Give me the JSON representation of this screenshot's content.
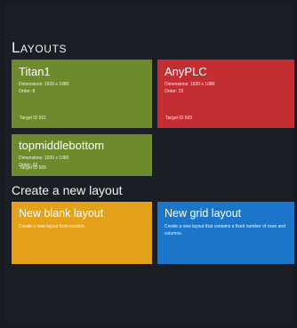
{
  "page": {
    "title": "Layouts"
  },
  "layouts": [
    {
      "name": "Titan1",
      "dimensions": "Dimensions: 1920 x 1080",
      "order": "Order: 8",
      "target": "Target ID 501",
      "color": "#6d8a2d"
    },
    {
      "name": "AnyPLC",
      "dimensions": "Dimensions: 1920 x 1080",
      "order": "Order: 15",
      "target": "Target ID 503",
      "color": "#c42d31"
    },
    {
      "name": "topmiddlebottom",
      "dimensions": "Dimensions: 1920 x 1080",
      "order": "Order: 22",
      "target": "Target ID 505",
      "color": "#6d8a2d"
    }
  ],
  "create": {
    "title": "Create a new layout",
    "blank": {
      "label": "New blank layout",
      "description": "Create a new layout from scratch.",
      "color": "#e3a21a"
    },
    "grid": {
      "label": "New grid layout",
      "description": "Create a new layout that contains a fixed number of rows and columns.",
      "color": "#1b76c9"
    }
  }
}
